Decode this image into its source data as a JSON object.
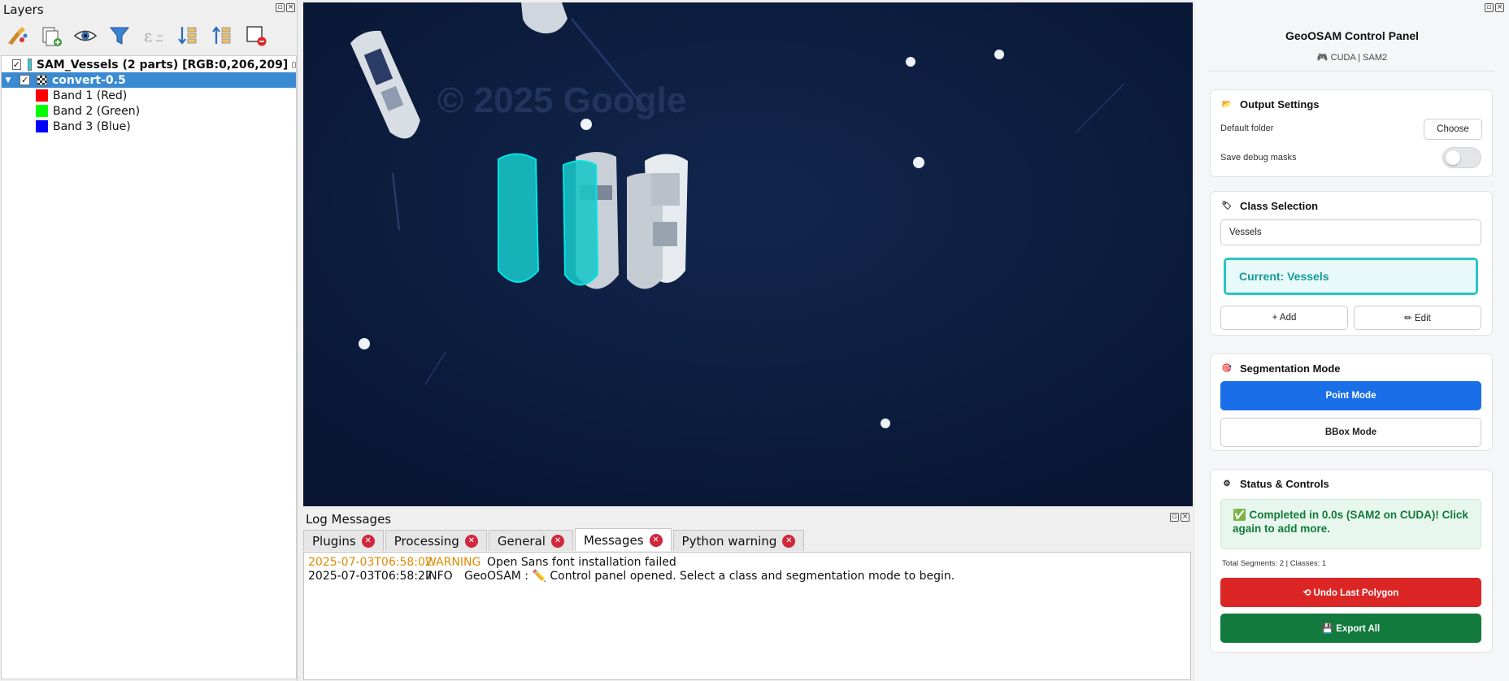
{
  "layers_panel": {
    "title": "Layers",
    "toolbar": [
      "style-manager-icon",
      "add-group-icon",
      "visibility-icon",
      "filter-icon",
      "expression-filter-icon",
      "expand-all-icon",
      "collapse-all-icon",
      "remove-layer-icon"
    ],
    "layers": [
      {
        "name": "SAM_Vessels (2 parts) [RGB:0,206,209]",
        "checked": true,
        "color": "#2ed0d0",
        "bold": true
      },
      {
        "name": "convert-0.5",
        "checked": true,
        "selected": true,
        "bold": true,
        "expanded": true,
        "bands": [
          {
            "name": "Band 1 (Red)",
            "color": "#ff0000"
          },
          {
            "name": "Band 2 (Green)",
            "color": "#00ff00"
          },
          {
            "name": "Band 3 (Blue)",
            "color": "#0000ff"
          }
        ]
      }
    ]
  },
  "map": {
    "watermark": "© 2025 Google",
    "segment_color": "#00ced1"
  },
  "log_panel": {
    "title": "Log Messages",
    "tabs": [
      {
        "label": "Plugins",
        "active": false
      },
      {
        "label": "Processing",
        "active": false
      },
      {
        "label": "General",
        "active": false
      },
      {
        "label": "Messages",
        "active": true
      },
      {
        "label": "Python warning",
        "active": false
      }
    ],
    "messages": [
      {
        "timestamp": "2025-07-03T06:58:02",
        "level": "WARNING",
        "text": "Open Sans font installation failed"
      },
      {
        "timestamp": "2025-07-03T06:58:27",
        "level": "INFO",
        "text": "GeoOSAM : ✏️ Control panel opened. Select a class and segmentation mode to begin."
      }
    ]
  },
  "control_panel": {
    "title": "GeoOSAM Control Panel",
    "subtitle": "🎮 CUDA | SAM2",
    "output_settings": {
      "heading": "Output Settings",
      "default_folder_label": "Default folder",
      "choose_label": "Choose",
      "debug_label": "Save debug masks",
      "debug_enabled": false
    },
    "class_selection": {
      "heading": "Class Selection",
      "selected_class": "Vessels",
      "current_label": "Current: Vessels",
      "add_label": "+ Add",
      "edit_label": "✏ Edit"
    },
    "segmentation_mode": {
      "heading": "Segmentation Mode",
      "point_label": "Point Mode",
      "bbox_label": "BBox Mode",
      "active": "point"
    },
    "status": {
      "heading": "Status & Controls",
      "message": "✅ Completed in 0.0s (SAM2 on CUDA)! Click again to add more.",
      "totals": "Total Segments: 2 | Classes: 1",
      "undo_label": "⟲ Undo Last Polygon",
      "export_label": "💾 Export All"
    }
  }
}
